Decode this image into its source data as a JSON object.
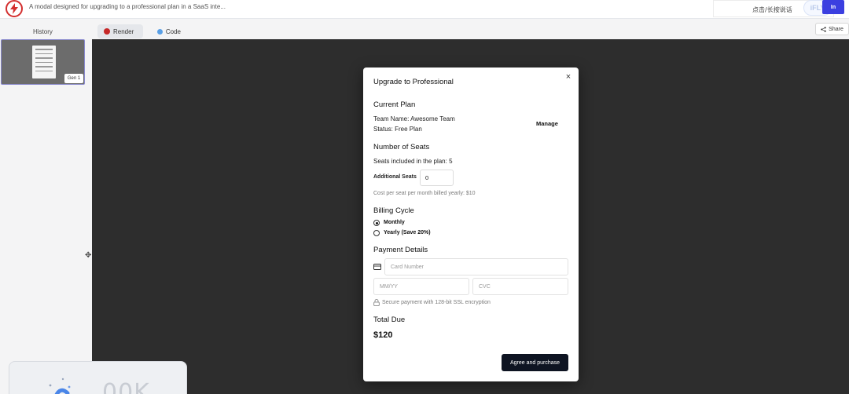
{
  "header": {
    "prompt_title": "A modal designed for upgrading to a professional plan in a SaaS inte...",
    "ime_text": "点击/长按说话",
    "ime_badge": "iFLY",
    "signin_label": "In"
  },
  "tabs": {
    "history": "History",
    "render": "Render",
    "code": "Code",
    "share": "Share"
  },
  "sidebar": {
    "gen_badge": "Gen 1"
  },
  "widget": {
    "text": "00K"
  },
  "modal": {
    "title": "Upgrade to Professional",
    "current_plan": {
      "heading": "Current Plan",
      "team_name": "Team Name: Awesome Team",
      "status": "Status: Free Plan",
      "manage_label": "Manage"
    },
    "seats": {
      "heading": "Number of Seats",
      "included": "Seats included in the plan: 5",
      "additional_label": "Additional Seats",
      "additional_value": "0",
      "cost_note": "Cost per seat per month billed yearly: $10"
    },
    "billing": {
      "heading": "Billing Cycle",
      "options": [
        {
          "label": "Monthly",
          "selected": true
        },
        {
          "label": "Yearly (Save 20%)",
          "selected": false
        }
      ]
    },
    "payment": {
      "heading": "Payment Details",
      "card_placeholder": "Card Number",
      "expiry_placeholder": "MM/YY",
      "cvc_placeholder": "CVC",
      "secure_note": "Secure payment with 128-bit SSL encryption"
    },
    "total": {
      "heading": "Total Due",
      "amount": "$120"
    },
    "purchase_label": "Agree and purchase"
  },
  "colors": {
    "canvas": "#2d2d2d",
    "primary_button": "#0e1422",
    "brand_red": "#d32f2f",
    "signin_blue": "#3b3fe0"
  }
}
